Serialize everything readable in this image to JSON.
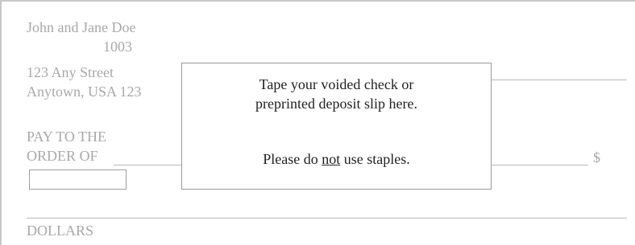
{
  "payer": {
    "name": "John and Jane Doe",
    "check_number": "1003",
    "street": "123 Any Street",
    "city": "Anytown, USA 123"
  },
  "pay_to_label_line1": "PAY TO THE",
  "pay_to_label_line2": "ORDER OF",
  "currency_symbol": "$",
  "dollars_label": "DOLLARS",
  "notice": {
    "line1": "Tape your voided check or",
    "line2": "preprinted deposit slip here.",
    "line3_before": "Please do ",
    "line3_emphasis": "not",
    "line3_after": " use staples."
  }
}
